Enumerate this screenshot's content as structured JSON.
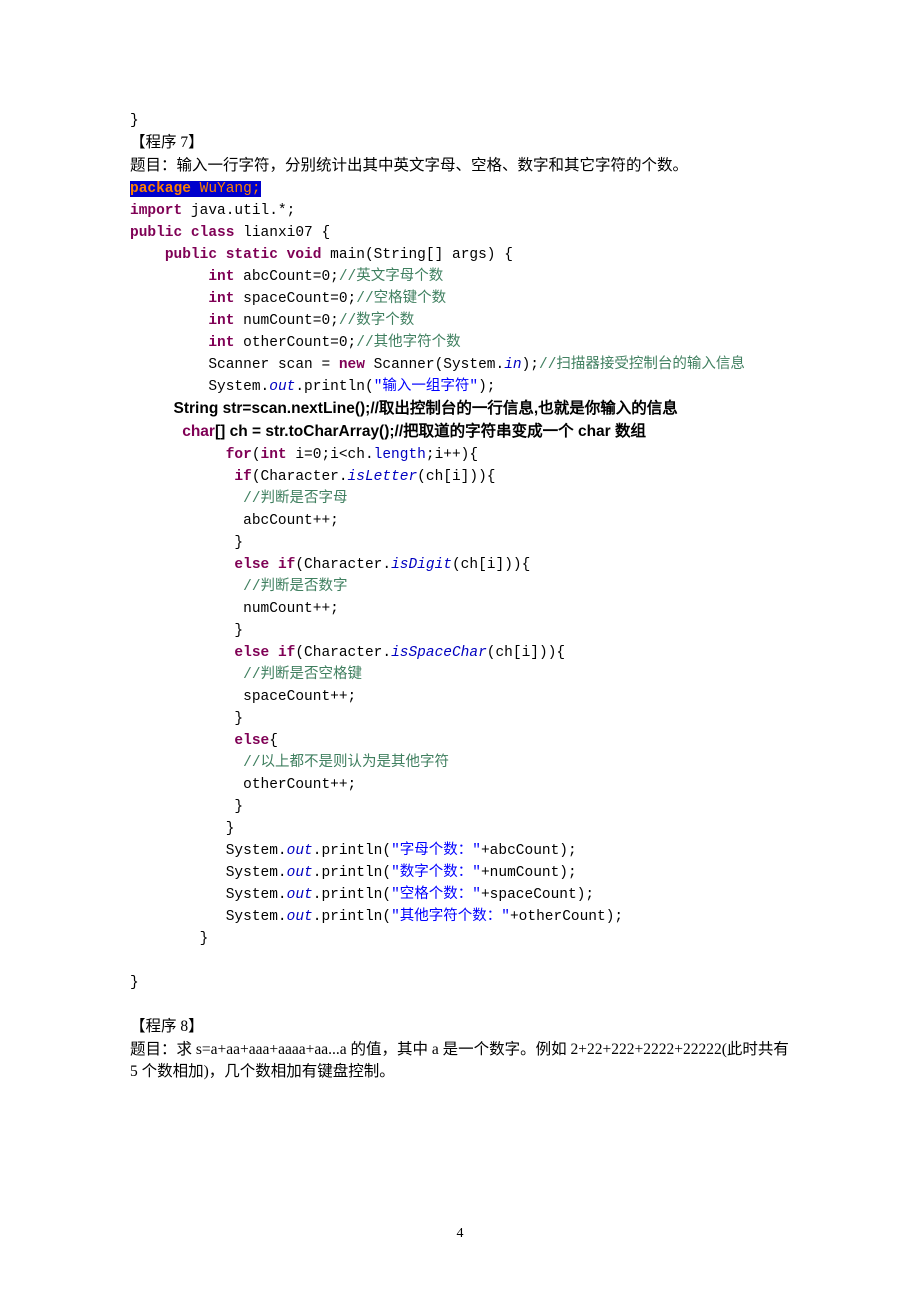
{
  "line1": "}",
  "prog7": "【程序 7】",
  "prog7desc": "题目：输入一行字符，分别统计出其中英文字母、空格、数字和其它字符的个数。",
  "pkg_kw": "package",
  "pkg_sp": " ",
  "pkg_name": "WuYang;",
  "imp_kw": "import",
  "imp_rest": " java.util.*;",
  "cls1": "public",
  "cls2": "class",
  "cls_name": " lianxi07 {",
  "main1": "public",
  "main2": "static",
  "main3": "void",
  "main_rest": " main(String[] args) {",
  "v_int": "int",
  "v_abc": " abcCount=0;",
  "c_abc": "//英文字母个数",
  "v_space": " spaceCount=0;",
  "c_space": "//空格键个数",
  "v_num": " numCount=0;",
  "c_num": "//数字个数",
  "v_other": " otherCount=0;",
  "c_other": "//其他字符个数",
  "scan1": "Scanner scan = ",
  "scan_new": "new",
  "scan2": " Scanner(System.",
  "scan_in": "in",
  "scan3": ");",
  "c_scan": "//扫描器接受控制台的输入信息",
  "sys_out": "out",
  "p_in1": "System.",
  "p_in2": ".println(",
  "s_input": "\"输入一组字符\"",
  "p_in3": ");",
  "line_str": "String str=scan.nextLine();//取出控制台的一行信息,也就是你输入的信息",
  "char_kw": "char",
  "line_char": "[] ch = str.toCharArray();//把取道的字符串变成一个 char 数组",
  "for_kw": "for",
  "for1": "(",
  "for_int": "int",
  "for2": " i=0;i<ch.",
  "for_len": "length",
  "for3": ";i++){",
  "if_kw": "if",
  "if1": "(Character.",
  "m_isLetter": "isLetter",
  "if2": "(ch[i])){",
  "c_letter": "//判断是否字母",
  "inc_abc": "abcCount++;",
  "brace_close": "}",
  "else_kw": "else",
  "elif1": "(Character.",
  "m_isDigit": "isDigit",
  "elif2": "(ch[i])){",
  "c_digit": "//判断是否数字",
  "inc_num": "numCount++;",
  "m_isSpace": "isSpaceChar",
  "c_spacek": "//判断是否空格键",
  "inc_space": "spaceCount++;",
  "else_open": "{",
  "c_else": "//以上都不是则认为是其他字符",
  "inc_other": "otherCount++;",
  "pr1": "System.",
  "pr2": ".println(",
  "s_letter": "\"字母个数：\"",
  "pr_abc": "+abcCount);",
  "s_digit": "\"数字个数：\"",
  "pr_num": "+numCount);",
  "s_space": "\"空格个数：\"",
  "pr_space": "+spaceCount);",
  "s_other": "\"其他字符个数：\"",
  "pr_other": "+otherCount);",
  "prog8": "【程序 8】",
  "prog8desc": "题目：求 s=a+aa+aaa+aaaa+aa...a 的值，其中 a 是一个数字。例如 2+22+222+2222+22222(此时共有 5 个数相加)，几个数相加有键盘控制。",
  "pagenum": "4"
}
